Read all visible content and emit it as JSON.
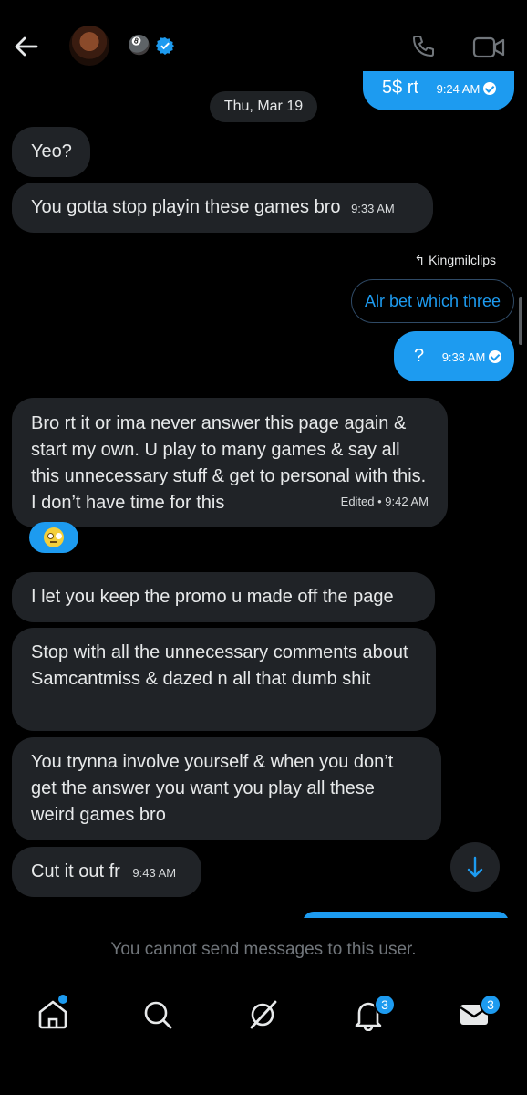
{
  "header": {
    "back_icon": "arrow-left-icon",
    "avatar": "profile-photo",
    "name": "🎱",
    "verified_icon": "verified-badge-icon",
    "call_icon": "phone-icon",
    "video_icon": "video-camera-icon"
  },
  "date_separator": "Thu, Mar 19",
  "messages": [
    {
      "text": "5$ rt",
      "time": "9:24 AM"
    },
    {
      "text": "Yeo?"
    },
    {
      "text": "You gotta stop playin these games bro",
      "time": "9:33 AM"
    },
    {
      "reply_context": "Kingmilclips",
      "quoted_text": "Alr bet which three"
    },
    {
      "text": "?",
      "time": "9:38 AM"
    },
    {
      "text": "Bro rt it or ima never answer this page again & start my own. U play to many games & say all this unnecessary stuff & get to personal with this. I don’t have time for this",
      "time": "Edited • 9:42 AM",
      "reaction": "🙄"
    },
    {
      "text": "I let you keep the promo u made off the page"
    },
    {
      "text": "Stop with all the unnecessary comments about Samcantmiss & dazed n all that dumb shit"
    },
    {
      "text": "You trynna involve yourself & when you don’t get the answer you want you play all these weird games bro"
    },
    {
      "text": "Cut it out fr",
      "time": "9:43 AM"
    }
  ],
  "scroll_down_icon": "arrow-down-icon",
  "notice": "You cannot send messages to this user.",
  "bottom_nav": [
    {
      "icon": "home-icon",
      "has_dot": true
    },
    {
      "icon": "search-icon"
    },
    {
      "icon": "grok-icon"
    },
    {
      "icon": "notifications-bell-icon",
      "badge": "3"
    },
    {
      "icon": "messages-envelope-icon",
      "badge": "3"
    }
  ],
  "colors": {
    "accent": "#1d9bf0",
    "bubble_in": "#202327",
    "background": "#000000"
  }
}
